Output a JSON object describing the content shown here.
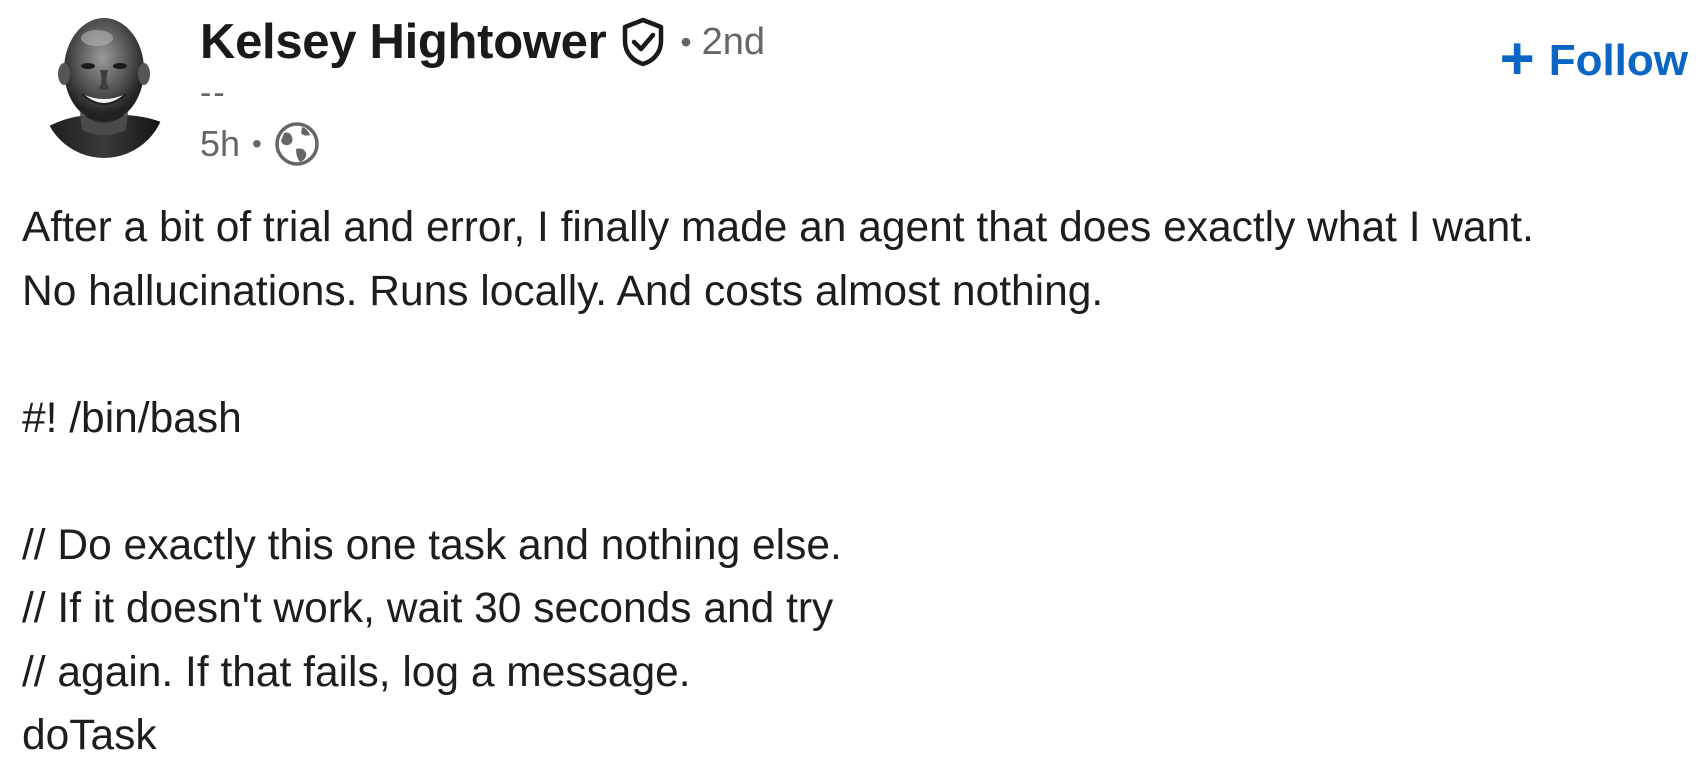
{
  "author": {
    "name": "Kelsey Hightower",
    "degree": "2nd",
    "headline": "--",
    "verified_icon": "shield-check-icon",
    "avatar_icon": "avatar-photo"
  },
  "meta": {
    "separator": "•",
    "time": "5h",
    "visibility_icon": "globe-icon"
  },
  "follow": {
    "label": "Follow",
    "icon": "+",
    "color": "#0a66c2"
  },
  "post": {
    "lines": [
      "After a bit of trial and error, I finally made an agent that does exactly what I want.",
      "No hallucinations. Runs locally. And costs almost nothing.",
      "",
      "#! /bin/bash",
      "",
      "// Do exactly this one task and nothing else.",
      "// If it doesn't work, wait 30 seconds and try",
      "// again. If that fails, log a message.",
      "doTask"
    ]
  },
  "colors": {
    "text": "#1d1d1d",
    "muted": "#666666",
    "link": "#0a66c2"
  }
}
